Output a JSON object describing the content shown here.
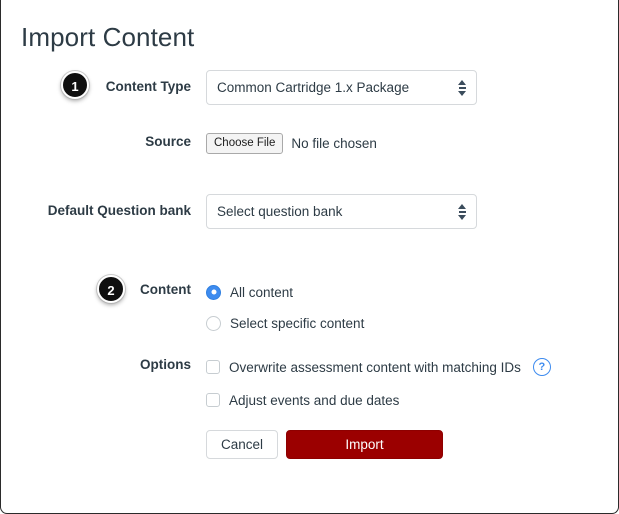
{
  "page": {
    "title": "Import Content"
  },
  "steps": [
    {
      "number": "1"
    },
    {
      "number": "2"
    }
  ],
  "form": {
    "content_type": {
      "label": "Content Type",
      "value": "Common Cartridge 1.x Package"
    },
    "source": {
      "label": "Source",
      "choose_file_label": "Choose File",
      "file_status": "No file chosen"
    },
    "question_bank": {
      "label": "Default Question bank",
      "value": "Select question bank"
    },
    "content": {
      "label": "Content",
      "options": [
        {
          "label": "All content",
          "selected": true
        },
        {
          "label": "Select specific content",
          "selected": false
        }
      ]
    },
    "options": {
      "label": "Options",
      "items": [
        {
          "label": "Overwrite assessment content with matching IDs",
          "checked": false,
          "help": "?"
        },
        {
          "label": "Adjust events and due dates",
          "checked": false
        }
      ]
    }
  },
  "actions": {
    "cancel_label": "Cancel",
    "import_label": "Import"
  },
  "colors": {
    "text": "#2D3B45",
    "primary_button": "#9B0000",
    "accent_blue": "#3d8bef",
    "border": "#d6d9dc"
  }
}
